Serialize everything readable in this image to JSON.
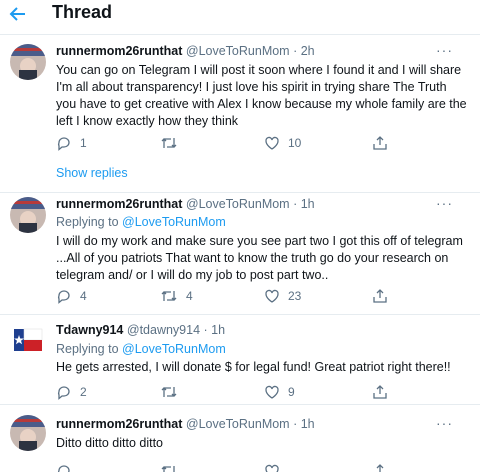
{
  "header": {
    "title": "Thread"
  },
  "tweets": [
    {
      "name": "runnermom26runthat",
      "handle": "@LoveToRunMom",
      "time": "· 2h",
      "lines": [
        "You can go on Telegram I will post it soon where I found it and I will share",
        "I'm all about transparency! I just love his spirit in trying share The Truth",
        "you have to get creative with Alex I know because my whole family are the",
        "left I know exactly how they think"
      ],
      "reply_count": "1",
      "retweet_count": "",
      "like_count": "10"
    },
    {
      "name": "runnermom26runthat",
      "handle": "@LoveToRunMom",
      "time": "· 1h",
      "replying_label": "Replying to",
      "replying_handle": "@LoveToRunMom",
      "lines": [
        "I will do my work and make sure you see part two I got this off of telegram",
        "...All of you patriots That want to know the truth go do your research on",
        "telegram  and/ or  I will do my job to post part two.."
      ],
      "reply_count": "4",
      "retweet_count": "4",
      "like_count": "23"
    },
    {
      "name": "Tdawny914",
      "handle": "@tdawny914",
      "time": "· 1h",
      "replying_label": "Replying to",
      "replying_handle": "@LoveToRunMom",
      "lines": [
        "He gets arrested, I will donate $ for legal fund!  Great patriot right there!!"
      ],
      "reply_count": "2",
      "retweet_count": "",
      "like_count": "9"
    },
    {
      "name": "runnermom26runthat",
      "handle": "@LoveToRunMom",
      "time": "· 1h",
      "lines": [
        "Ditto ditto ditto ditto"
      ],
      "reply_count": "",
      "retweet_count": "",
      "like_count": ""
    }
  ],
  "show_replies": "Show replies",
  "colors": {
    "accent": "#1d9bf0",
    "muted": "#5b7083",
    "divider": "#e6ecf0",
    "text": "#0f1419"
  },
  "icons": [
    "back-arrow-icon",
    "more-icon",
    "reply-icon",
    "retweet-icon",
    "like-icon",
    "share-icon",
    "texas-flag-icon"
  ]
}
